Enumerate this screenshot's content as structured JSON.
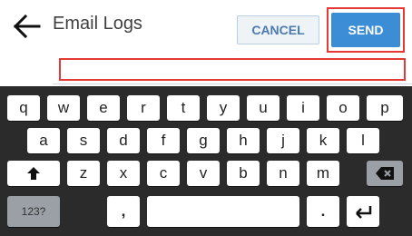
{
  "header": {
    "title": "Email Logs",
    "cancel_label": "CANCEL",
    "send_label": "SEND",
    "back_icon": "arrow-left-icon"
  },
  "email_field": {
    "value": "",
    "placeholder": ""
  },
  "keyboard": {
    "row1": [
      "q",
      "w",
      "e",
      "r",
      "t",
      "y",
      "u",
      "i",
      "o",
      "p"
    ],
    "row2": [
      "a",
      "s",
      "d",
      "f",
      "g",
      "h",
      "j",
      "k",
      "l"
    ],
    "row3": [
      "z",
      "x",
      "c",
      "v",
      "b",
      "n",
      "m"
    ],
    "symbols_label": "123?",
    "comma": ",",
    "period": ".",
    "icons": {
      "shift": "shift-arrow-icon",
      "backspace": "backspace-icon",
      "enter": "enter-return-icon"
    }
  },
  "colors": {
    "accent": "#3b8dd6",
    "highlight": "#e53935",
    "keyboard_bg": "#2b2b2b"
  }
}
